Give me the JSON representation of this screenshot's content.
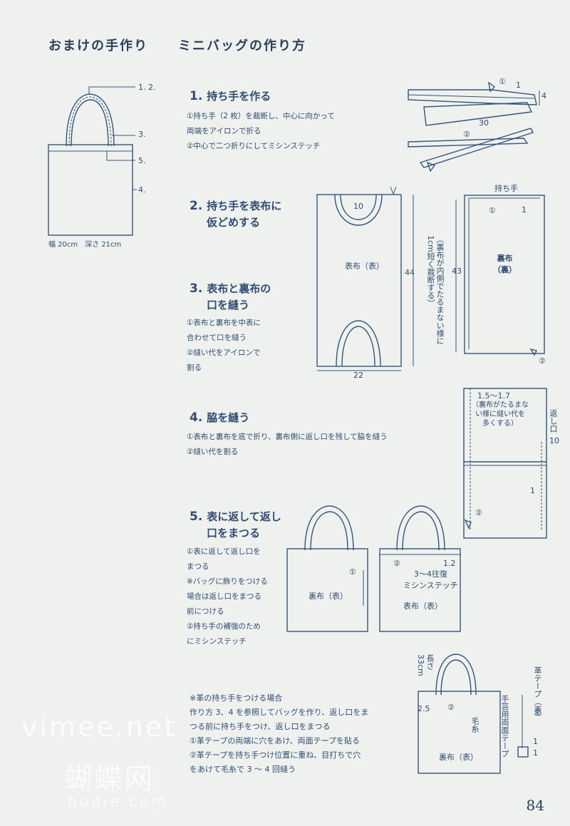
{
  "header": {
    "title_main": "おまけの手作り",
    "title_sub": "ミニバッグの作り方"
  },
  "overview": {
    "callouts": [
      "1. 2.",
      "3.",
      "5.",
      "4."
    ],
    "size_text": "幅 20cm　深さ 21cm"
  },
  "steps": [
    {
      "num": "1.",
      "title": "持ち手を作る",
      "notes": [
        "①持ち手（2 枚）を裁断し、中心に向かって",
        "両端をアイロンで折る",
        "②中心で二つ折りにしてミシンステッチ"
      ]
    },
    {
      "num": "2.",
      "title": "持ち手を表布に",
      "title2": "仮どめする"
    },
    {
      "num": "3.",
      "title": "表布と裏布の",
      "title2": "口を縫う",
      "notes": [
        "①表布と裏布を中表に",
        "合わせて口を縫う",
        "②縫い代をアイロンで",
        "割る"
      ]
    },
    {
      "num": "4.",
      "title": "脇を縫う",
      "notes": [
        "①表布と裏布を底で折り、裏布側に返し口を残して脇を縫う",
        "②縫い代を割る"
      ]
    },
    {
      "num": "5.",
      "title": "表に返して返し",
      "title2": "口をまつる",
      "notes": [
        "①表に返して返し口を",
        "まつる",
        "※バッグに飾りをつける",
        "場合は返し口をまつる",
        "前につける",
        "②持ち手の補強のため",
        "にミシンステッチ"
      ]
    }
  ],
  "diagram1": {
    "labels": [
      "①",
      "1",
      "4",
      "30",
      "②"
    ]
  },
  "diagram23": {
    "outer_label": "表布（表）",
    "lining_label": "裏布",
    "lining_sub": "（裏）",
    "handle_label": "持ち手",
    "labels": [
      "10",
      "44",
      "22",
      "43",
      "①",
      "1",
      "②"
    ],
    "vertical_note": "（裏布が内側でたるまない様に1cm短く裁断する）"
  },
  "diagram4": {
    "measure": "1.5～1.7",
    "note_lines": [
      "（裏布がたるまな",
      "い様に縫い代を",
      "多くする）"
    ],
    "return_label": "返し口",
    "return_value": "10",
    "labels": [
      "1",
      "②"
    ]
  },
  "diagram5": {
    "left_label": "裏布（表）",
    "right_label": "表布（表）",
    "stitch_label": "3～4往復",
    "stitch_label2": "ミシンステッチ",
    "labels": [
      "①",
      "②",
      "1.2"
    ]
  },
  "leather": {
    "heading": "※革の持ち手をつける場合",
    "lines": [
      "作り方 3、4 を参照してバッグを作り、返し口をま",
      "つる前に持ち手をつけ、返し口をまつる",
      "①革テープの両端に穴をあけ、両面テープを貼る",
      "②革テープを持ち手つけ位置に重ね、目打ちで穴",
      "をあけて毛糸で 3 ～ 4 回縫う"
    ],
    "length_label": "長さ33cm",
    "bag_label": "裏布（表）",
    "yarn_label": "毛糸",
    "tape_label": "革テープ（表）",
    "double_tape_label": "手芸用両面テープ",
    "labels": [
      "2.5",
      "②",
      "①",
      "1",
      "1"
    ]
  },
  "page_number": "84",
  "watermark": {
    "line1": "vimee.net",
    "line2": "蝴蝶网",
    "line3": "hudie.com"
  }
}
